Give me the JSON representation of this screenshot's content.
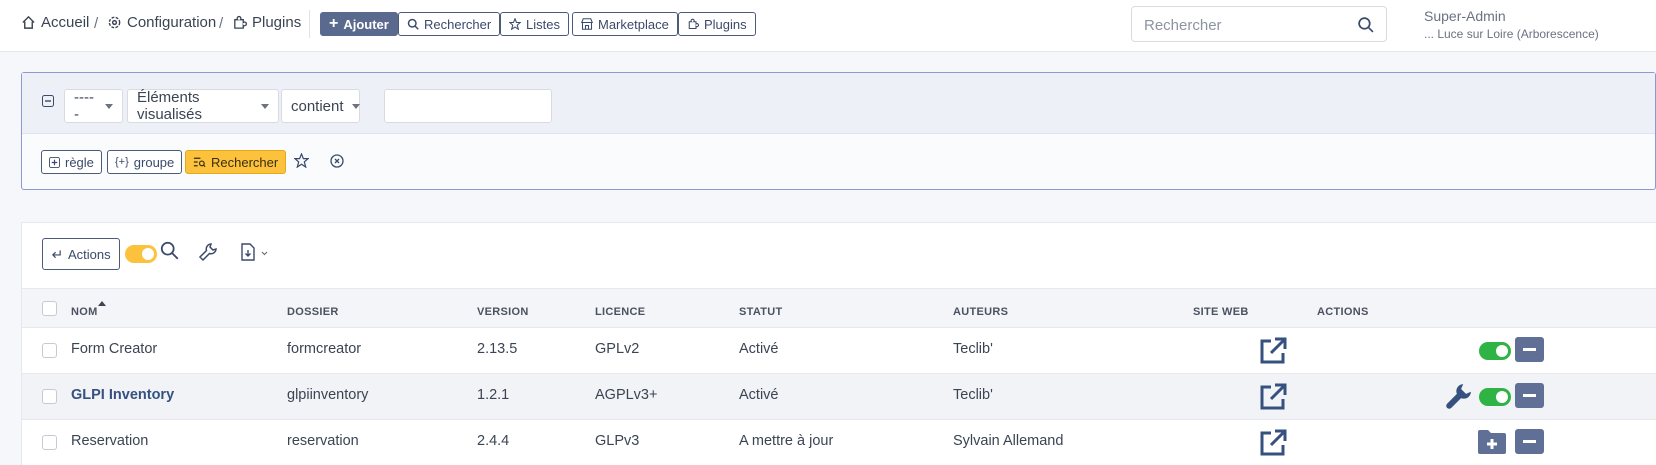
{
  "breadcrumb": {
    "home": "Accueil",
    "config": "Configuration",
    "plugins": "Plugins",
    "separator": "/"
  },
  "toolbar": {
    "add": "Ajouter",
    "search": "Rechercher",
    "lists": "Listes",
    "marketplace": "Marketplace",
    "plugins": "Plugins"
  },
  "global_search": {
    "placeholder": "Rechercher"
  },
  "user": {
    "name": "Super-Admin",
    "entity": "... Luce sur Loire (Arborescence)"
  },
  "criteria": {
    "link_select": "-----",
    "field_select": "Éléments visualisés",
    "operator_select": "contient",
    "value": "",
    "rule_btn": "règle",
    "group_btn": "groupe",
    "search_btn": "Rechercher"
  },
  "results": {
    "actions_btn": "Actions",
    "columns": [
      "NOM",
      "DOSSIER",
      "VERSION",
      "LICENCE",
      "STATUT",
      "AUTEURS",
      "SITE WEB",
      "ACTIONS"
    ],
    "rows": [
      {
        "name": "Form Creator",
        "folder": "formcreator",
        "version": "2.13.5",
        "license": "GPLv2",
        "status": "Activé",
        "authors": "Teclib'"
      },
      {
        "name": "GLPI Inventory",
        "folder": "glpiinventory",
        "version": "1.2.1",
        "license": "AGPLv3+",
        "status": "Activé",
        "authors": "Teclib'"
      },
      {
        "name": "Reservation",
        "folder": "reservation",
        "version": "2.4.4",
        "license": "GLPv3",
        "status": "A mettre à jour",
        "authors": "Sylvain Allemand"
      }
    ]
  },
  "colors": {
    "primary": "#5a6a8e",
    "accent_yellow": "#fcc23d",
    "toggle_green": "#2fb344",
    "link": "#36507f"
  }
}
